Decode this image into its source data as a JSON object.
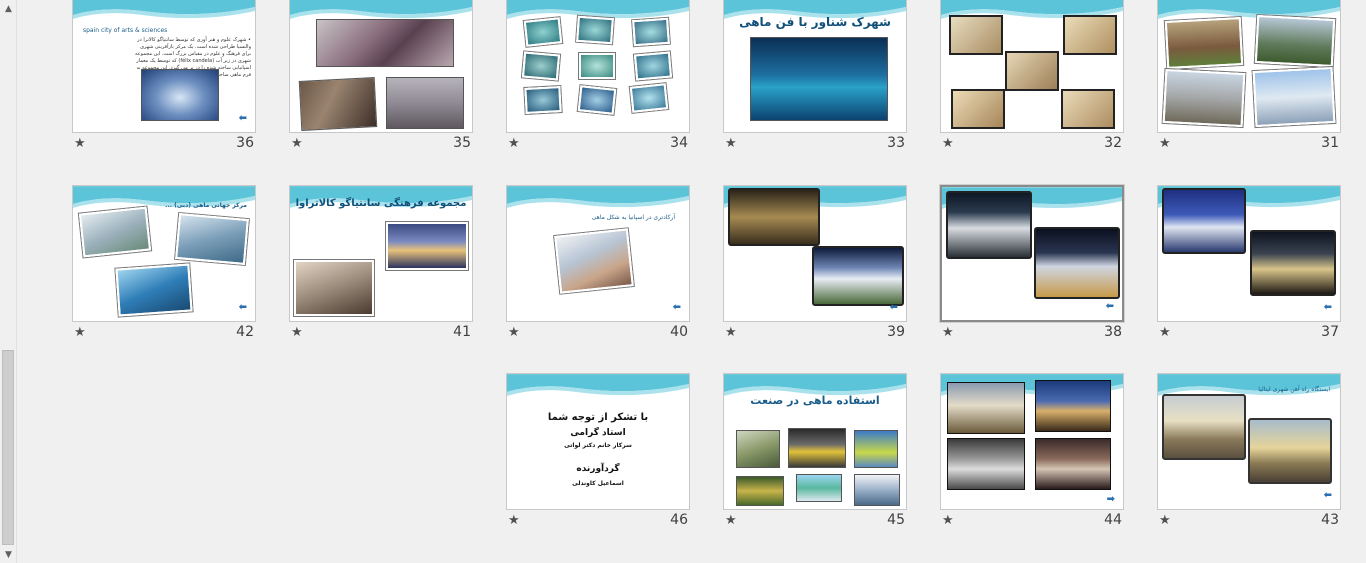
{
  "slides": [
    {
      "number": "36",
      "heading": "spain city of arts & sciences",
      "body": "• شهرک علوم و هنر آوری که توسط سانتیاگو کالاترا در والنسیا طراحی شده است. یک مرکز بازآفرینی شهری برای فرهنگ و علوم در مقیاس بزرگ است. این مجموعه شهری در زیر آب (félix candela) که توسط یک معمار اسپانیایی ساخته شده را در بر می گیرد. این مجموعه به فرم ماهی ساخته شده است."
    },
    {
      "number": "35"
    },
    {
      "number": "34"
    },
    {
      "number": "33",
      "title": "شهرک شناور با فن ماهی"
    },
    {
      "number": "32"
    },
    {
      "number": "31"
    },
    {
      "number": "42",
      "title": "... مرکز جهانی ماهی (دبی)"
    },
    {
      "number": "41",
      "title": "مجموعه فرهنگی سانتیاگو کالاتراوا"
    },
    {
      "number": "40",
      "title": "آرکادتری در اسپانیا به شکل ماهی"
    },
    {
      "number": "39"
    },
    {
      "number": "38",
      "selected": true
    },
    {
      "number": "37"
    },
    {
      "number": "46",
      "lines": [
        "با تشکر از توجه شما",
        "استاد گرامی",
        "سرکار خانم دکتر لواتی",
        "گردآورنده",
        "اسماعیل کاوندلی"
      ]
    },
    {
      "number": "45",
      "title": "استفاده ماهی در صنعت"
    },
    {
      "number": "44"
    },
    {
      "number": "43",
      "title": "ایستگاه راه آهن شهری ایتالیا"
    }
  ],
  "icons": {
    "star": "★",
    "nav_arrow": "⬅",
    "nav_arrow_right": "➡",
    "scroll_up": "▲",
    "scroll_down": "▼"
  },
  "colors": {
    "wave": "#5cc4d8",
    "title": "#1a5d8a",
    "background": "#f0f0f0"
  }
}
